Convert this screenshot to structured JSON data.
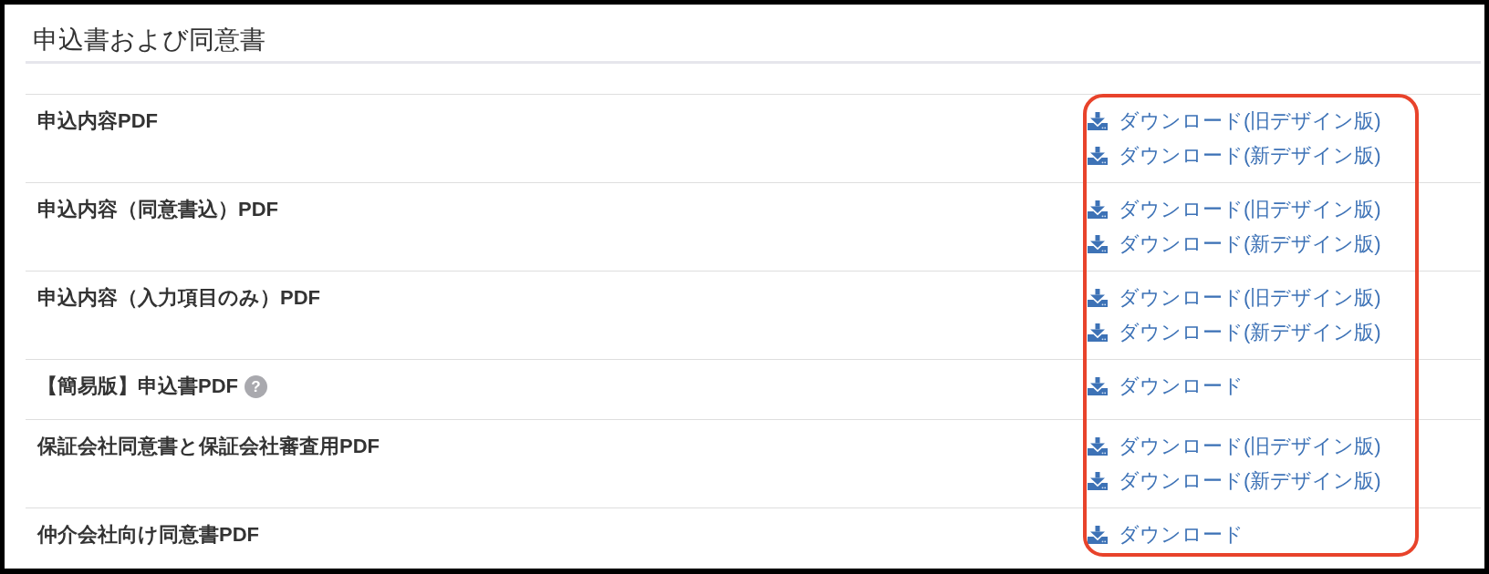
{
  "title": "申込書および同意書",
  "download_column_highlighted": true,
  "rows": [
    {
      "label": "申込内容PDF",
      "links": [
        "ダウンロード(旧デザイン版)",
        "ダウンロード(新デザイン版)"
      ]
    },
    {
      "label": "申込内容（同意書込）PDF",
      "links": [
        "ダウンロード(旧デザイン版)",
        "ダウンロード(新デザイン版)"
      ]
    },
    {
      "label": "申込内容（入力項目のみ）PDF",
      "links": [
        "ダウンロード(旧デザイン版)",
        "ダウンロード(新デザイン版)"
      ]
    },
    {
      "label": "【簡易版】申込書PDF",
      "help": "?",
      "links": [
        "ダウンロード"
      ]
    },
    {
      "label": "保証会社同意書と保証会社審査用PDF",
      "links": [
        "ダウンロード(旧デザイン版)",
        "ダウンロード(新デザイン版)"
      ]
    },
    {
      "label": "仲介会社向け同意書PDF",
      "links": [
        "ダウンロード"
      ]
    }
  ]
}
